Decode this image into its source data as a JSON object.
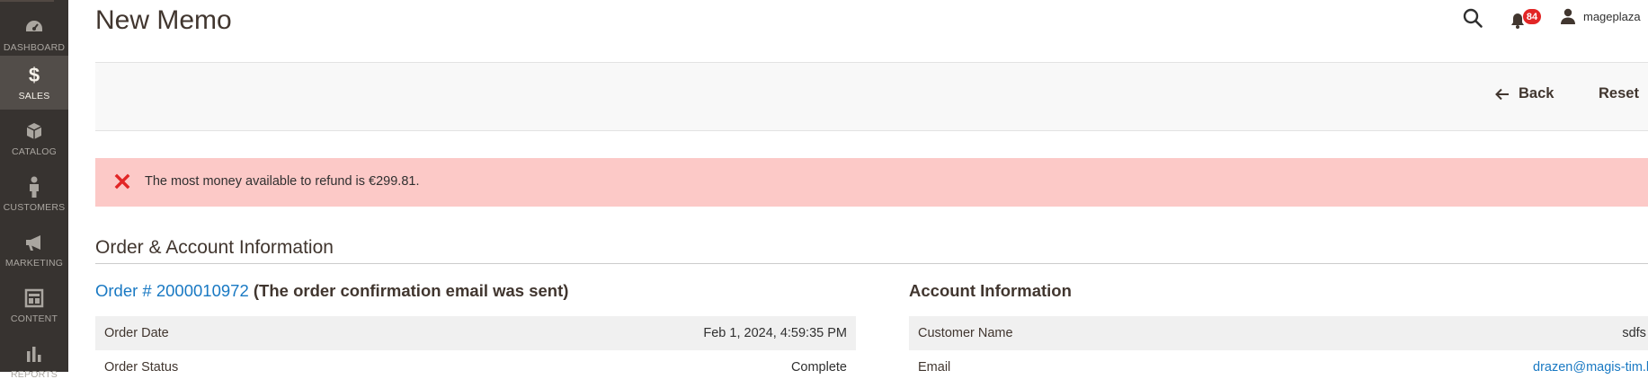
{
  "sidebar": {
    "items": [
      {
        "label": "DASHBOARD",
        "icon": "dashboard-icon",
        "active": false
      },
      {
        "label": "SALES",
        "icon": "dollar-icon",
        "active": true
      },
      {
        "label": "CATALOG",
        "icon": "box-icon",
        "active": false
      },
      {
        "label": "CUSTOMERS",
        "icon": "person-icon",
        "active": false
      },
      {
        "label": "MARKETING",
        "icon": "megaphone-icon",
        "active": false
      },
      {
        "label": "CONTENT",
        "icon": "layout-icon",
        "active": false
      },
      {
        "label": "REPORTS",
        "icon": "bar-chart-icon",
        "active": false
      }
    ]
  },
  "header": {
    "title": "New Memo",
    "notifications_count": "84",
    "username": "mageplaza"
  },
  "actions": {
    "back_label": "Back",
    "reset_label": "Reset"
  },
  "message": {
    "type": "error",
    "text": "The most money available to refund is €299.81."
  },
  "section": {
    "title": "Order & Account Information"
  },
  "order": {
    "link_text": "Order # 2000010972",
    "note": " (The order confirmation email was sent)",
    "rows": [
      {
        "label": "Order Date",
        "value": "Feb 1, 2024, 4:59:35 PM"
      },
      {
        "label": "Order Status",
        "value": "Complete"
      }
    ]
  },
  "account": {
    "title": "Account Information",
    "rows": [
      {
        "label": "Customer Name",
        "value": "sdfs f"
      },
      {
        "label": "Email",
        "value": "drazen@magis-tim.h"
      }
    ]
  },
  "colors": {
    "sidebar_bg": "#373330",
    "sidebar_active": "#524d49",
    "link": "#1979c3",
    "error_bg": "#fcc9c7",
    "error_icon": "#e22626",
    "badge": "#e22626"
  }
}
